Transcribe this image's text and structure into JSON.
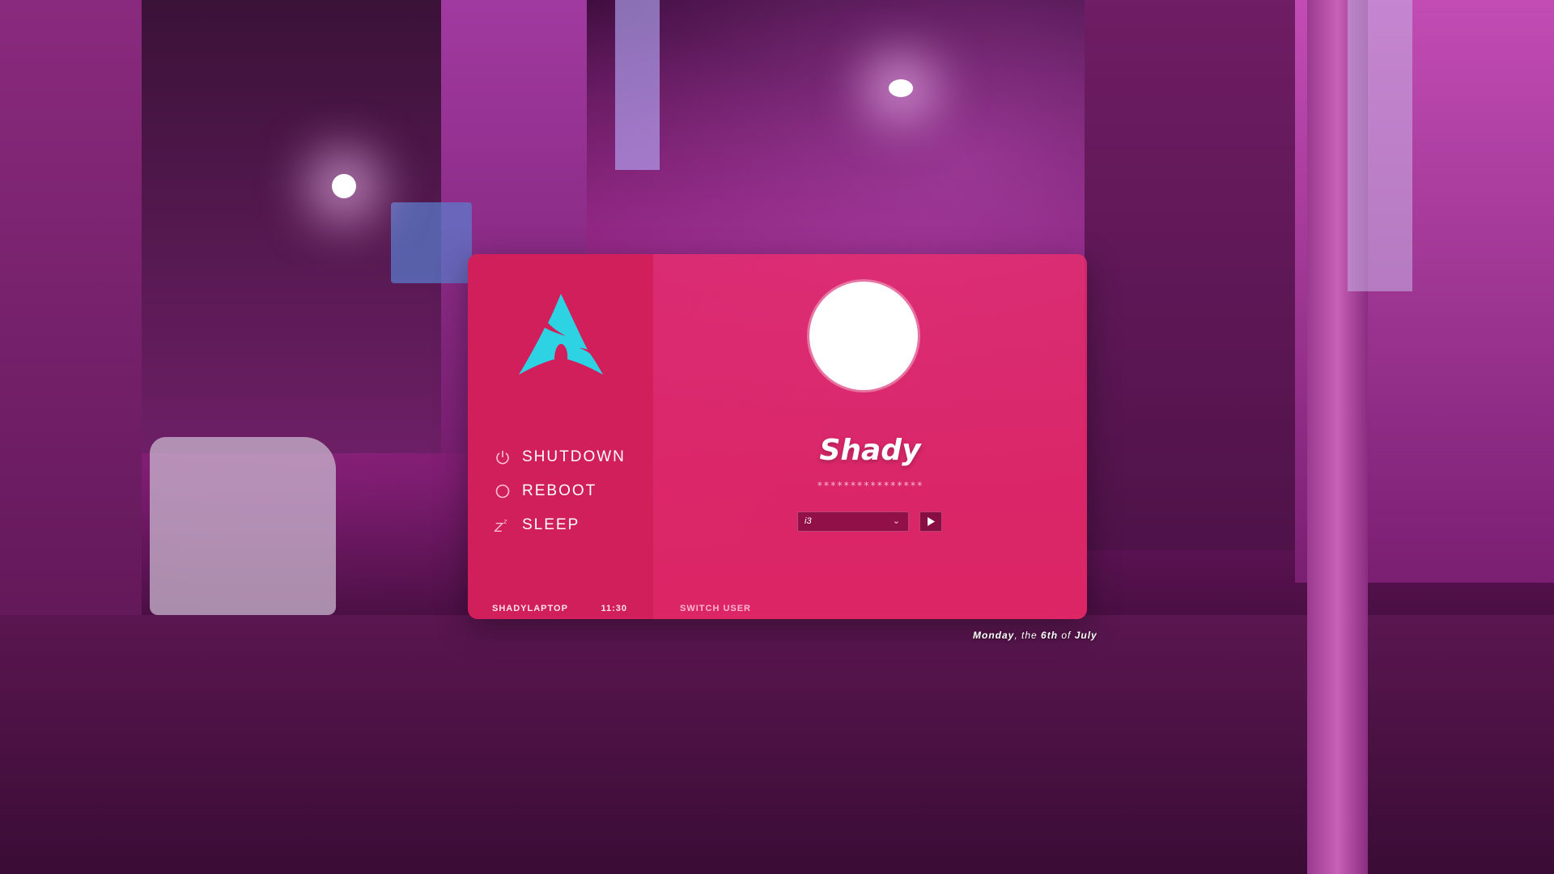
{
  "colors": {
    "sidebar": "#d01f5a",
    "accent_logo": "#2dd3e3",
    "panel": "#ec2c6c"
  },
  "sidebar": {
    "logo_icon": "arch-linux-logo",
    "power_menu": [
      {
        "label": "SHUTDOWN",
        "icon": "power-icon"
      },
      {
        "label": "REBOOT",
        "icon": "reboot-icon"
      },
      {
        "label": "SLEEP",
        "icon": "sleep-icon"
      }
    ],
    "hostname": "SHADYLAPTOP",
    "time": "11:30"
  },
  "main": {
    "username": "Shady",
    "password_mask": "****************",
    "session": {
      "selected": "i3"
    },
    "submit_icon": "play-icon",
    "switch_user_label": "SWITCH USER"
  },
  "date": {
    "weekday": "Monday",
    "sep1": ", the ",
    "day": "6th",
    "sep2": " of ",
    "month": "July"
  }
}
